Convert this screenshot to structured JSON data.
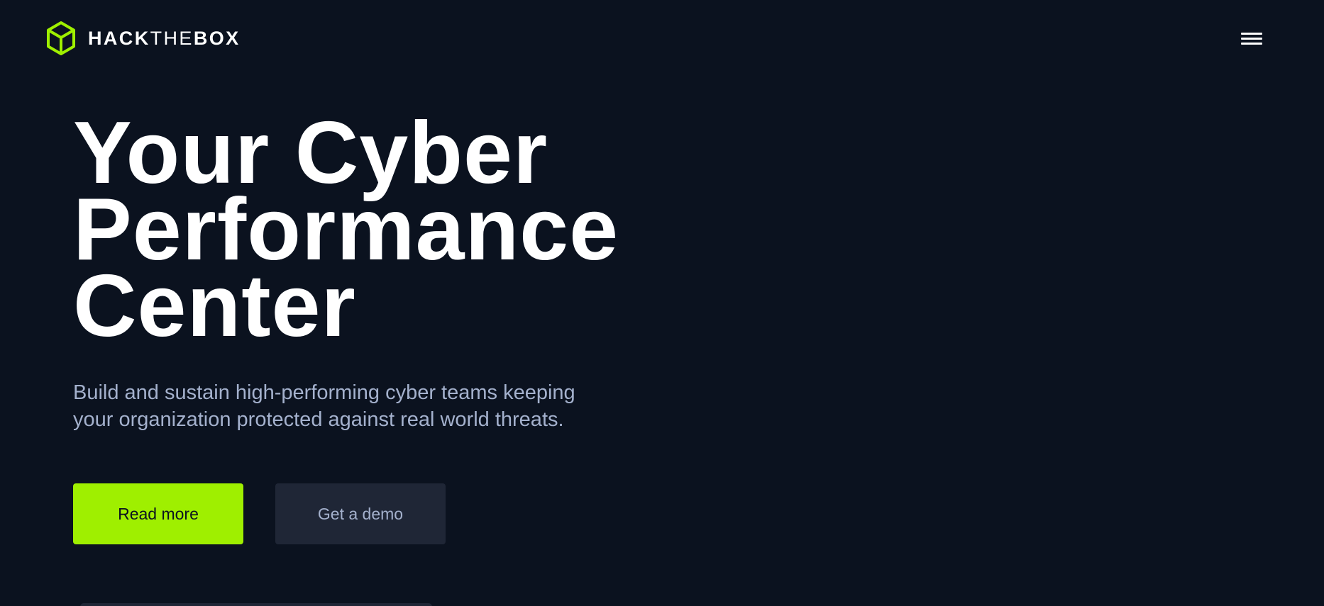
{
  "header": {
    "logo": {
      "icon": "hack-the-box-cube-icon",
      "word_hack": "HACK",
      "word_the": "THE",
      "word_box": "BOX"
    },
    "menu_icon": "hamburger-menu-icon"
  },
  "hero": {
    "title_lines": [
      "Your Cyber",
      "Performance",
      "Center"
    ],
    "subtitle_lines": [
      "Build and sustain high-performing cyber teams keeping",
      "your organization protected against real world threats."
    ],
    "primary_button": "Read more",
    "secondary_button": "Get a demo"
  },
  "colors": {
    "background": "#0b121f",
    "accent": "#9fef00",
    "secondary_button_bg": "#1f2636",
    "subtitle_text": "#a4b1cd",
    "title_text": "#ffffff"
  }
}
